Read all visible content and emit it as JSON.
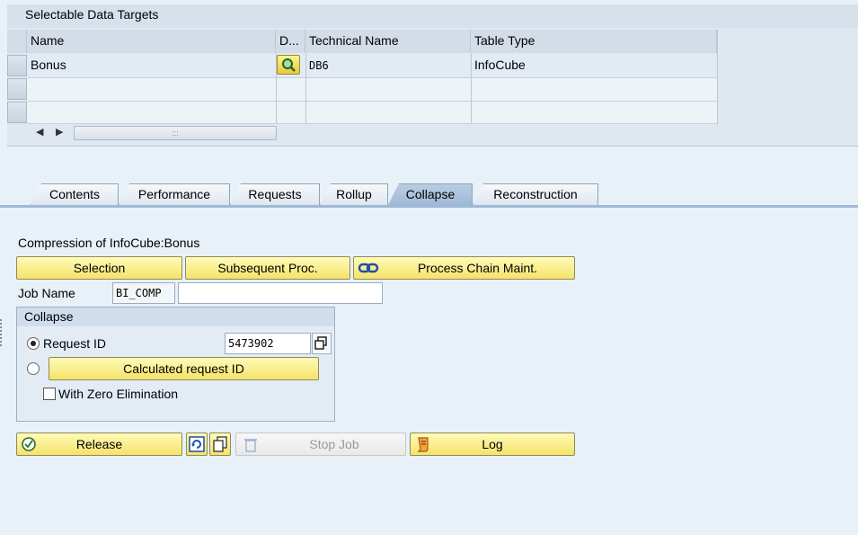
{
  "table": {
    "title": "Selectable Data Targets",
    "columns": [
      "Name",
      "D...",
      "Technical Name",
      "Table Type"
    ],
    "rows": [
      {
        "name": "Bonus",
        "technical_name": "DB6",
        "table_type": "InfoCube"
      }
    ],
    "scroll_grip": ":::"
  },
  "tabs": [
    {
      "label": "Contents"
    },
    {
      "label": "Performance"
    },
    {
      "label": "Requests"
    },
    {
      "label": "Rollup"
    },
    {
      "label": "Collapse"
    },
    {
      "label": "Reconstruction"
    }
  ],
  "active_tab": "Collapse",
  "content": {
    "heading": "Compression of InfoCube:Bonus",
    "selection_label": "Selection",
    "subsequent_label": "Subsequent Proc.",
    "process_chain_label": "Process Chain Maint.",
    "job_name_label": "Job Name",
    "job_name_prefix": "BI_COMP",
    "job_name_value": "",
    "collapse_group_title": "Collapse",
    "request_id_label": "Request ID",
    "request_id_value": "5473902",
    "calculated_request_label": "Calculated request ID",
    "zero_elimination_label": "With Zero Elimination",
    "release_label": "Release",
    "stop_job_label": "Stop Job",
    "log_label": "Log"
  },
  "colors": {
    "button_yellow": "#f5e36a",
    "active_tab": "#9fb9d6",
    "panel": "#e8f0f8"
  }
}
